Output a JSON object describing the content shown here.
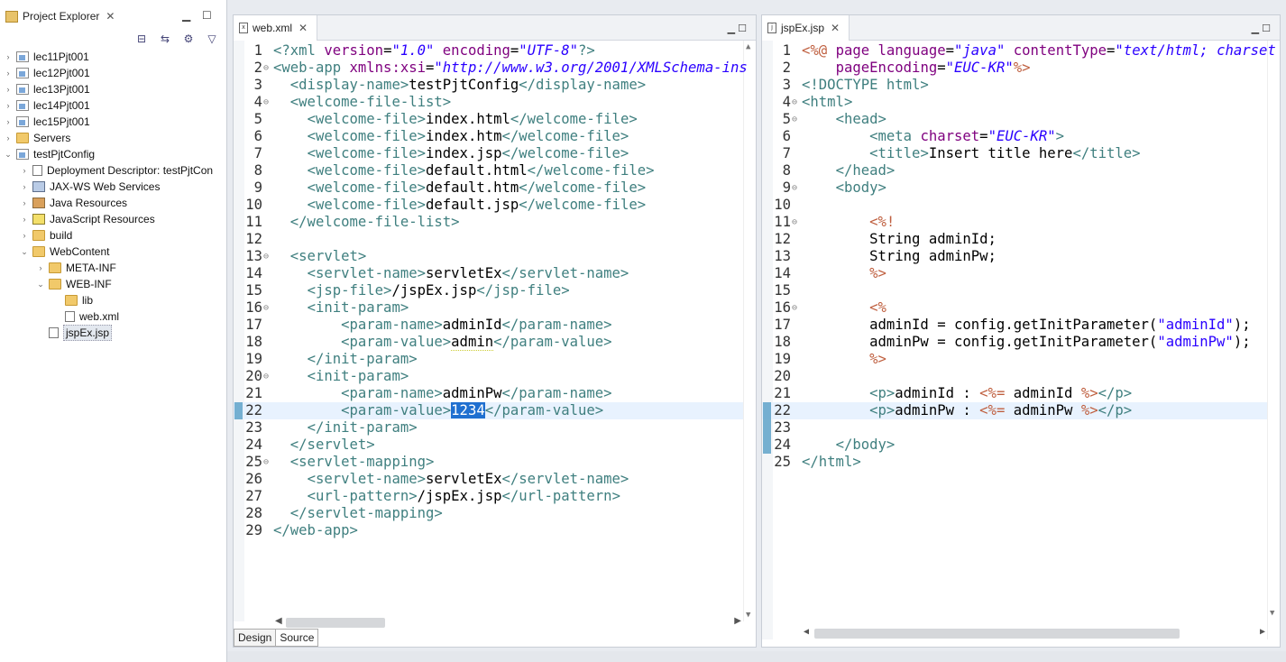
{
  "explorer": {
    "title": "Project Explorer",
    "items": [
      {
        "label": "lec11Pjt001",
        "level": 0,
        "twist": "closed",
        "icon": "project-icon"
      },
      {
        "label": "lec12Pjt001",
        "level": 0,
        "twist": "closed",
        "icon": "project-icon"
      },
      {
        "label": "lec13Pjt001",
        "level": 0,
        "twist": "closed",
        "icon": "project-icon"
      },
      {
        "label": "lec14Pjt001",
        "level": 0,
        "twist": "closed",
        "icon": "project-icon"
      },
      {
        "label": "lec15Pjt001",
        "level": 0,
        "twist": "closed",
        "icon": "project-icon"
      },
      {
        "label": "Servers",
        "level": 0,
        "twist": "closed",
        "icon": "folder-icon"
      },
      {
        "label": "testPjtConfig",
        "level": 0,
        "twist": "open",
        "icon": "project-icon"
      },
      {
        "label": "Deployment Descriptor: testPjtCon",
        "level": 1,
        "twist": "closed",
        "icon": "descriptor-icon"
      },
      {
        "label": "JAX-WS Web Services",
        "level": 1,
        "twist": "closed",
        "icon": "webservice-icon"
      },
      {
        "label": "Java Resources",
        "level": 1,
        "twist": "closed",
        "icon": "java-resources-icon"
      },
      {
        "label": "JavaScript Resources",
        "level": 1,
        "twist": "closed",
        "icon": "javascript-resources-icon"
      },
      {
        "label": "build",
        "level": 1,
        "twist": "closed",
        "icon": "folder-icon"
      },
      {
        "label": "WebContent",
        "level": 1,
        "twist": "open",
        "icon": "folder-icon"
      },
      {
        "label": "META-INF",
        "level": 2,
        "twist": "closed",
        "icon": "folder-icon"
      },
      {
        "label": "WEB-INF",
        "level": 2,
        "twist": "open",
        "icon": "folder-icon"
      },
      {
        "label": "lib",
        "level": 3,
        "twist": "none",
        "icon": "folder-icon"
      },
      {
        "label": "web.xml",
        "level": 3,
        "twist": "none",
        "icon": "xml-file-icon"
      },
      {
        "label": "jspEx.jsp",
        "level": 2,
        "twist": "none",
        "icon": "jsp-file-icon",
        "selected": true
      }
    ]
  },
  "editor1": {
    "tab": "web.xml",
    "bottom_tabs": [
      "Design",
      "Source"
    ],
    "active_bottom_tab": "Source",
    "current_line": 22,
    "lines": [
      {
        "n": "1",
        "fold": "",
        "html": "<span class='tag'>&lt;?xml</span> <span class='attr'>version</span>=<span class='val'>\"1.0\"</span> <span class='attr'>encoding</span>=<span class='val'>\"UTF-8\"</span><span class='tag'>?&gt;</span>"
      },
      {
        "n": "2",
        "fold": "⊖",
        "html": "<span class='tag'>&lt;web-app</span> <span class='attr'>xmlns:xsi</span>=<span class='val'>\"http://www.w3.org/2001/XMLSchema-ins</span>"
      },
      {
        "n": "3",
        "fold": "",
        "html": "  <span class='tag'>&lt;display-name&gt;</span>testPjtConfig<span class='tag'>&lt;/display-name&gt;</span>"
      },
      {
        "n": "4",
        "fold": "⊖",
        "html": "  <span class='tag'>&lt;welcome-file-list&gt;</span>"
      },
      {
        "n": "5",
        "fold": "",
        "html": "    <span class='tag'>&lt;welcome-file&gt;</span>index.html<span class='tag'>&lt;/welcome-file&gt;</span>"
      },
      {
        "n": "6",
        "fold": "",
        "html": "    <span class='tag'>&lt;welcome-file&gt;</span>index.htm<span class='tag'>&lt;/welcome-file&gt;</span>"
      },
      {
        "n": "7",
        "fold": "",
        "html": "    <span class='tag'>&lt;welcome-file&gt;</span>index.jsp<span class='tag'>&lt;/welcome-file&gt;</span>"
      },
      {
        "n": "8",
        "fold": "",
        "html": "    <span class='tag'>&lt;welcome-file&gt;</span>default.html<span class='tag'>&lt;/welcome-file&gt;</span>"
      },
      {
        "n": "9",
        "fold": "",
        "html": "    <span class='tag'>&lt;welcome-file&gt;</span>default.htm<span class='tag'>&lt;/welcome-file&gt;</span>"
      },
      {
        "n": "10",
        "fold": "",
        "html": "    <span class='tag'>&lt;welcome-file&gt;</span>default.jsp<span class='tag'>&lt;/welcome-file&gt;</span>"
      },
      {
        "n": "11",
        "fold": "",
        "html": "  <span class='tag'>&lt;/welcome-file-list&gt;</span>"
      },
      {
        "n": "12",
        "fold": "",
        "html": ""
      },
      {
        "n": "13",
        "fold": "⊖",
        "html": "  <span class='tag'>&lt;servlet&gt;</span>"
      },
      {
        "n": "14",
        "fold": "",
        "html": "    <span class='tag'>&lt;servlet-name&gt;</span>servletEx<span class='tag'>&lt;/servlet-name&gt;</span>"
      },
      {
        "n": "15",
        "fold": "",
        "html": "    <span class='tag'>&lt;jsp-file&gt;</span>/jspEx.jsp<span class='tag'>&lt;/jsp-file&gt;</span>"
      },
      {
        "n": "16",
        "fold": "⊖",
        "html": "    <span class='tag'>&lt;init-param&gt;</span>"
      },
      {
        "n": "17",
        "fold": "",
        "html": "        <span class='tag'>&lt;param-name&gt;</span>adminId<span class='tag'>&lt;/param-name&gt;</span>"
      },
      {
        "n": "18",
        "fold": "",
        "html": "        <span class='tag'>&lt;param-value&gt;</span><span class='squig'>admin</span><span class='tag'>&lt;/param-value&gt;</span>"
      },
      {
        "n": "19",
        "fold": "",
        "html": "    <span class='tag'>&lt;/init-param&gt;</span>"
      },
      {
        "n": "20",
        "fold": "⊖",
        "html": "    <span class='tag'>&lt;init-param&gt;</span>"
      },
      {
        "n": "21",
        "fold": "",
        "html": "        <span class='tag'>&lt;param-name&gt;</span>adminPw<span class='tag'>&lt;/param-name&gt;</span>"
      },
      {
        "n": "22",
        "fold": "",
        "html": "        <span class='tag'>&lt;param-value&gt;</span><span class='sel'>1234</span><span class='tag'>&lt;/param-value&gt;</span>"
      },
      {
        "n": "23",
        "fold": "",
        "html": "    <span class='tag'>&lt;/init-param&gt;</span>"
      },
      {
        "n": "24",
        "fold": "",
        "html": "  <span class='tag'>&lt;/servlet&gt;</span>"
      },
      {
        "n": "25",
        "fold": "⊖",
        "html": "  <span class='tag'>&lt;servlet-mapping&gt;</span>"
      },
      {
        "n": "26",
        "fold": "",
        "html": "    <span class='tag'>&lt;servlet-name&gt;</span>servletEx<span class='tag'>&lt;/servlet-name&gt;</span>"
      },
      {
        "n": "27",
        "fold": "",
        "html": "    <span class='tag'>&lt;url-pattern&gt;</span>/jspEx.jsp<span class='tag'>&lt;/url-pattern&gt;</span>"
      },
      {
        "n": "28",
        "fold": "",
        "html": "  <span class='tag'>&lt;/servlet-mapping&gt;</span>"
      },
      {
        "n": "29",
        "fold": "",
        "html": "<span class='tag'>&lt;/web-app&gt;</span>"
      }
    ]
  },
  "editor2": {
    "tab": "jspEx.jsp",
    "current_line": 22,
    "lines": [
      {
        "n": "1",
        "fold": "",
        "html": "<span class='jspd'>&lt;%@</span> <span class='attr'>page</span> <span class='attr'>language</span>=<span class='val'>\"java\"</span> <span class='attr'>contentType</span>=<span class='val'>\"text/html; charset</span>"
      },
      {
        "n": "2",
        "fold": "",
        "html": "    <span class='attr'>pageEncoding</span>=<span class='val'>\"EUC-KR\"</span><span class='jspd'>%&gt;</span>"
      },
      {
        "n": "3",
        "fold": "",
        "html": "<span class='tag'>&lt;!DOCTYPE html&gt;</span>"
      },
      {
        "n": "4",
        "fold": "⊖",
        "html": "<span class='tag'>&lt;html&gt;</span>"
      },
      {
        "n": "5",
        "fold": "⊖",
        "html": "    <span class='tag'>&lt;head&gt;</span>"
      },
      {
        "n": "6",
        "fold": "",
        "html": "        <span class='tag'>&lt;meta</span> <span class='attr'>charset</span>=<span class='val'>\"EUC-KR\"</span><span class='tag'>&gt;</span>"
      },
      {
        "n": "7",
        "fold": "",
        "html": "        <span class='tag'>&lt;title&gt;</span>Insert title here<span class='tag'>&lt;/title&gt;</span>"
      },
      {
        "n": "8",
        "fold": "",
        "html": "    <span class='tag'>&lt;/head&gt;</span>"
      },
      {
        "n": "9",
        "fold": "⊖",
        "html": "    <span class='tag'>&lt;body&gt;</span>"
      },
      {
        "n": "10",
        "fold": "",
        "html": ""
      },
      {
        "n": "11",
        "fold": "⊖",
        "html": "        <span class='jspd'>&lt;%!</span>"
      },
      {
        "n": "12",
        "fold": "",
        "html": "        String adminId;"
      },
      {
        "n": "13",
        "fold": "",
        "html": "        String adminPw;"
      },
      {
        "n": "14",
        "fold": "",
        "html": "        <span class='jspd'>%&gt;</span>"
      },
      {
        "n": "15",
        "fold": "",
        "html": ""
      },
      {
        "n": "16",
        "fold": "⊖",
        "html": "        <span class='jspd'>&lt;%</span>"
      },
      {
        "n": "17",
        "fold": "",
        "html": "        adminId = config.getInitParameter(<span class='str'>\"adminId\"</span>);"
      },
      {
        "n": "18",
        "fold": "",
        "html": "        adminPw = config.getInitParameter(<span class='str'>\"adminPw\"</span>);"
      },
      {
        "n": "19",
        "fold": "",
        "html": "        <span class='jspd'>%&gt;</span>"
      },
      {
        "n": "20",
        "fold": "",
        "html": ""
      },
      {
        "n": "21",
        "fold": "",
        "html": "        <span class='tag'>&lt;p&gt;</span>adminId : <span class='jspd'>&lt;%=</span> adminId <span class='jspd'>%&gt;</span><span class='tag'>&lt;/p&gt;</span>"
      },
      {
        "n": "22",
        "fold": "",
        "html": "        <span class='tag'>&lt;p&gt;</span>adminPw : <span class='jspd'>&lt;%=</span> adminPw <span class='jspd'>%&gt;</span><span class='tag'>&lt;/p&gt;</span>"
      },
      {
        "n": "23",
        "fold": "",
        "html": ""
      },
      {
        "n": "24",
        "fold": "",
        "html": "    <span class='tag'>&lt;/body&gt;</span>"
      },
      {
        "n": "25",
        "fold": "",
        "html": "<span class='tag'>&lt;/html&gt;</span>"
      }
    ]
  },
  "colors": {
    "tag": "#3f7f7f",
    "attribute": "#7f007f",
    "value": "#2a00ff",
    "jsp_delimiter": "#bf5f3f",
    "selection": "#1f6fd0",
    "current_line": "#e8f2fe"
  }
}
